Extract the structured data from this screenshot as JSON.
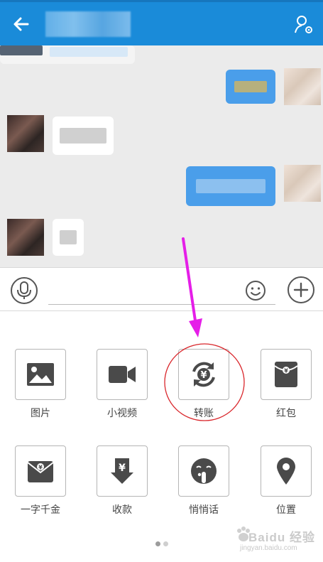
{
  "header": {
    "back_icon": "back-arrow-icon",
    "profile_icon": "user-settings-icon",
    "background": "#1a8bd9"
  },
  "chat": {
    "background": "#ebebeb",
    "outgoing_bubble_color": "#4a9eea",
    "incoming_bubble_color": "#ffffff"
  },
  "input_bar": {
    "voice_icon": "microphone-icon",
    "emoji_icon": "smile-icon",
    "plus_icon": "plus-icon",
    "value": ""
  },
  "panel": {
    "tiles": [
      {
        "label": "图片",
        "icon": "image-icon"
      },
      {
        "label": "小视频",
        "icon": "video-camera-icon"
      },
      {
        "label": "转账",
        "icon": "transfer-yuan-icon"
      },
      {
        "label": "红包",
        "icon": "red-envelope-icon"
      },
      {
        "label": "一字千金",
        "icon": "envelope-yuan-icon"
      },
      {
        "label": "收款",
        "icon": "receive-money-icon"
      },
      {
        "label": "悄悄话",
        "icon": "whisper-face-icon"
      },
      {
        "label": "位置",
        "icon": "location-pin-icon"
      }
    ],
    "page_indicator": {
      "total": 2,
      "current": 1
    }
  },
  "annotation": {
    "arrow_color": "#e51ee8",
    "circle_color": "#d9262b",
    "target": "转账"
  },
  "watermark": {
    "main": "Baidu 经验",
    "sub": "jingyan.baidu.com"
  }
}
